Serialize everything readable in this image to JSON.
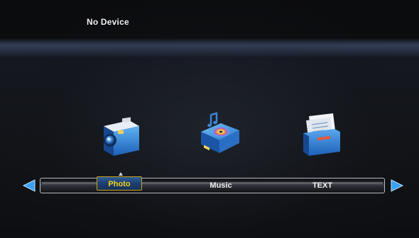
{
  "header": {
    "device_status": "No Device"
  },
  "menu": {
    "items": [
      {
        "label": "Photo",
        "icon": "camera-icon",
        "selected": true
      },
      {
        "label": "Music",
        "icon": "music-projector-icon",
        "selected": false
      },
      {
        "label": "TEXT",
        "icon": "document-folder-icon",
        "selected": false
      }
    ],
    "nav": {
      "left": "left-arrow-icon",
      "right": "right-arrow-icon"
    }
  },
  "colors": {
    "selected_text": "#f5d21a",
    "selected_bg": "#2c5c98",
    "arrow": "#3aa0f0",
    "text": "#f0f0f0"
  }
}
